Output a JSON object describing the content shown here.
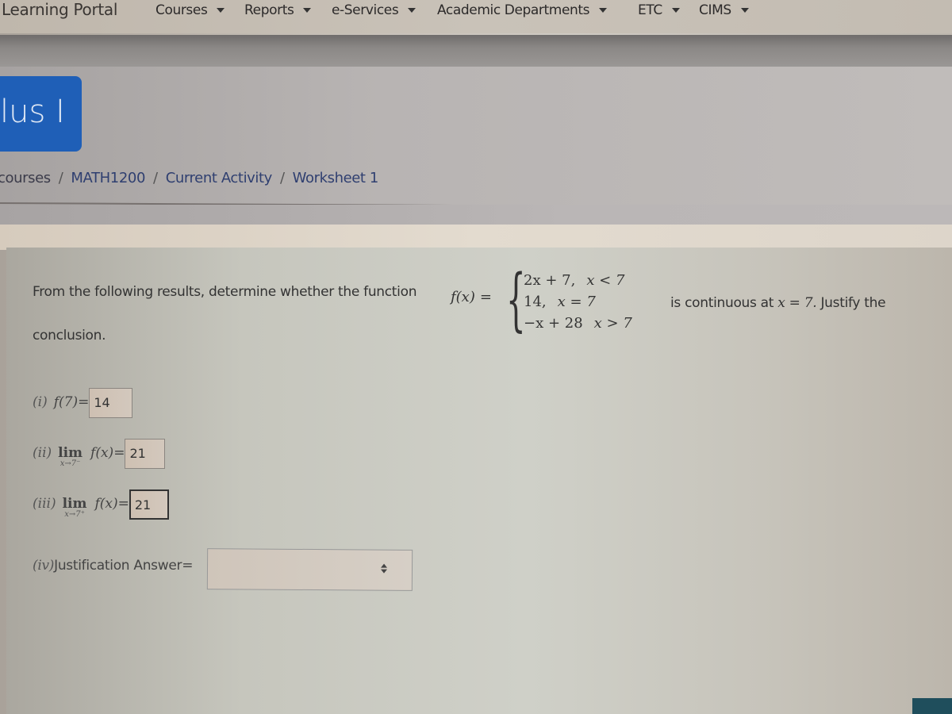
{
  "navbar": {
    "brand": "Learning Portal",
    "items": [
      {
        "label": "Courses"
      },
      {
        "label": "Reports"
      },
      {
        "label": "e-Services"
      },
      {
        "label": "Academic Departments"
      },
      {
        "label": "ETC"
      },
      {
        "label": "CIMS"
      }
    ]
  },
  "course": {
    "title_fragment": "lus I"
  },
  "breadcrumb": [
    "courses",
    "MATH1200",
    "Current Activity",
    "Worksheet 1"
  ],
  "breadcrumb_separator": "/",
  "question": {
    "intro": "From the following results, determine whether the function",
    "function": "f(x)",
    "equals": "=",
    "cases": [
      {
        "expr": "2x + 7,",
        "cond": "x < 7"
      },
      {
        "expr": "14,",
        "cond": "x = 7"
      },
      {
        "expr": "−x + 28",
        "cond": "x > 7"
      }
    ],
    "after_text": "is continuous at",
    "after_math": "x = 7.",
    "after_tail": "Justify the",
    "conclusion": "conclusion."
  },
  "parts": [
    {
      "label": "(i)",
      "expr": "f(7)=",
      "answer": "14"
    },
    {
      "label": "(ii)",
      "lim": "lim",
      "sub": "x→7⁻",
      "expr": "f(x)=",
      "answer": "21"
    },
    {
      "label": "(iii)",
      "lim": "lim",
      "sub": "x→7⁺",
      "expr": "f(x)=",
      "answer": "21"
    }
  ],
  "justification": {
    "label": "(iv)",
    "text": "Justification Answer=",
    "selected": ""
  }
}
